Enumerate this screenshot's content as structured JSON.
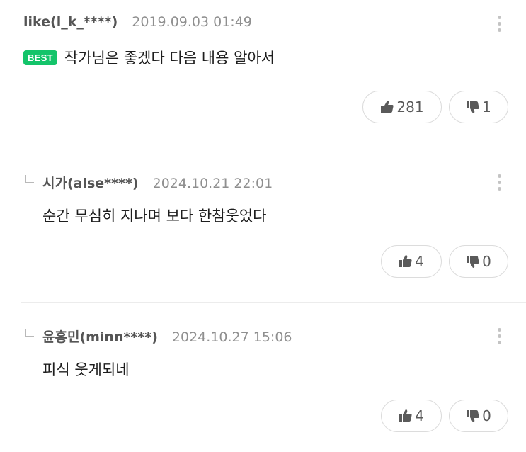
{
  "comments": [
    {
      "author": "like(l_k_****)",
      "date": "2019.09.03 01:49",
      "badge": "BEST",
      "text": "작가님은 좋겠다 다음 내용 알아서",
      "likes": "281",
      "dislikes": "1",
      "is_reply": false
    },
    {
      "author": "시가(alse****)",
      "date": "2024.10.21 22:01",
      "text": "순간  무심히 지나며 보다 한참웃었다",
      "likes": "4",
      "dislikes": "0",
      "is_reply": true
    },
    {
      "author": "윤홍민(minn****)",
      "date": "2024.10.27 15:06",
      "text": "피식 웃게되네",
      "likes": "4",
      "dislikes": "0",
      "is_reply": true
    }
  ],
  "icons": {
    "like": "thumbs-up-icon",
    "dislike": "thumbs-down-icon",
    "more": "more-vertical-icon",
    "reply": "reply-arrow-icon"
  },
  "colors": {
    "best_badge": "#14c46a",
    "author": "#555555",
    "date": "#8f8f8f",
    "divider": "#ececec"
  }
}
